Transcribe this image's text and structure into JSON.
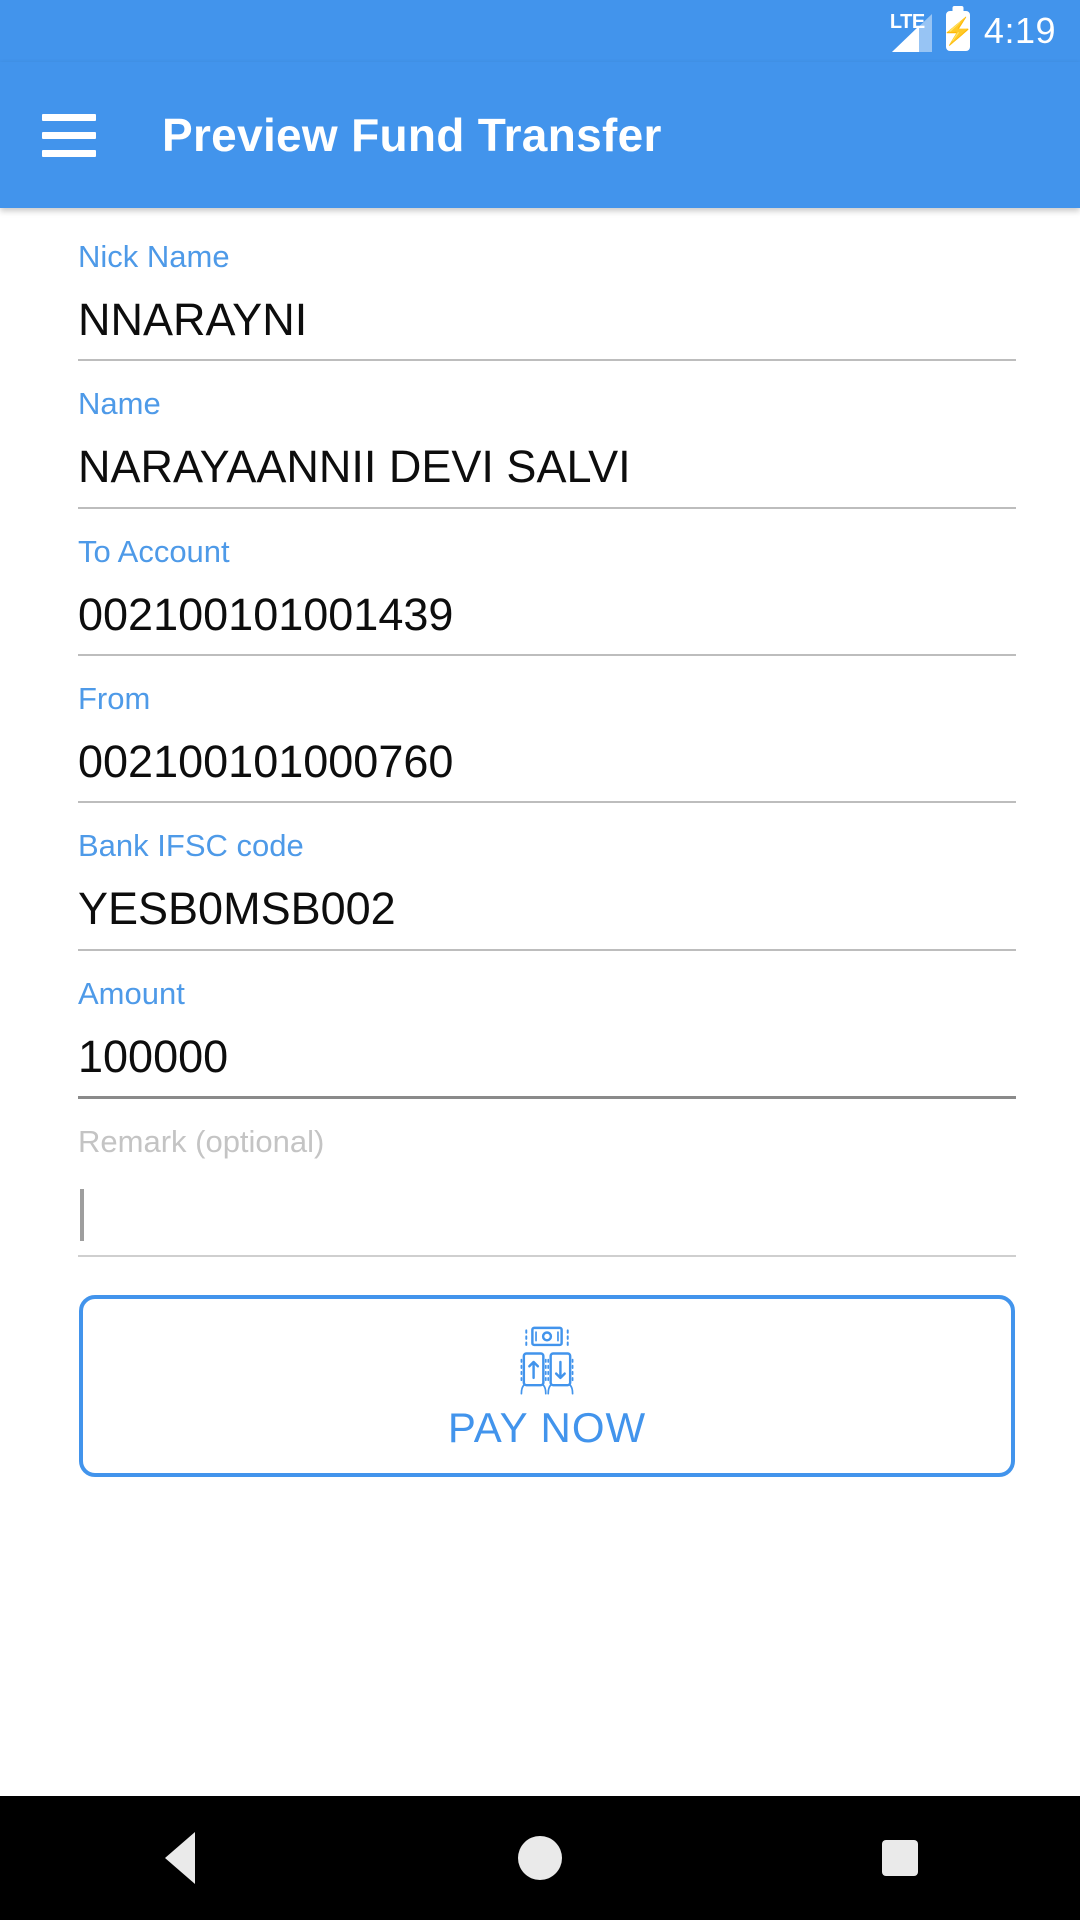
{
  "status_bar": {
    "network_label": "LTE",
    "signal_icon": "signal-triangle-icon",
    "battery_icon": "battery-charging-icon",
    "time": "4:19"
  },
  "app_bar": {
    "menu_icon": "hamburger-menu-icon",
    "title": "Preview Fund Transfer",
    "background_color": "#4294ec"
  },
  "form": {
    "fields": [
      {
        "label": "Nick Name",
        "value": "NNARAYNI",
        "state": "filled"
      },
      {
        "label": "Name",
        "value": "NARAYAANNII DEVI SALVI",
        "state": "filled"
      },
      {
        "label": "To Account",
        "value": "002100101001439",
        "state": "filled"
      },
      {
        "label": "From",
        "value": "002100101000760",
        "state": "filled"
      },
      {
        "label": "Bank IFSC code",
        "value": "YESB0MSB002",
        "state": "filled"
      },
      {
        "label": "Amount",
        "value": "100000",
        "state": "focused"
      }
    ],
    "remark": {
      "label": "Remark (optional)",
      "placeholder": "Remark (optional)",
      "value": "",
      "state": "empty-focused"
    }
  },
  "pay_button": {
    "icon": "money-transfer-icon",
    "label": "PAY NOW",
    "accent_color": "#4294ec"
  },
  "nav_bar": {
    "back_label": "back-button",
    "home_label": "home-button",
    "recents_label": "recents-button"
  },
  "colors": {
    "accent_blue": "#4294ec",
    "label_blue": "#4e9ae8",
    "value_black": "#0d0d0d",
    "muted_gray": "#c4c4c4",
    "underline_gray": "#bdbdbd"
  }
}
